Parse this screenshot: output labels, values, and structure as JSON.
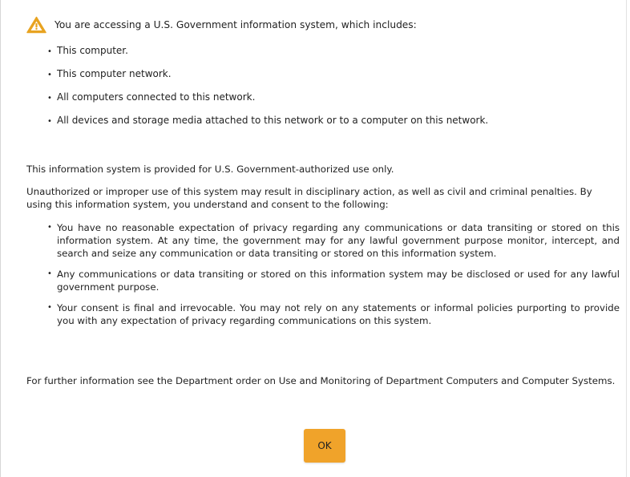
{
  "header": {
    "icon": "warning-icon",
    "warning_color": "#e8a320",
    "text": "You are accessing a U.S. Government information system, which includes:"
  },
  "includes": [
    "This computer.",
    "This computer network.",
    "All computers connected to this network.",
    "All devices and storage media attached to this network or to a computer on this network."
  ],
  "para_authorized": "This information system is provided for U.S. Government-authorized use only.",
  "para_unauthorized": "Unauthorized or improper use of this system may result in disciplinary action, as well as civil and criminal penalties. By using this information system, you understand and consent to the following:",
  "consent": [
    "You have no reasonable expectation of privacy regarding any communications or data transiting or stored on this information system. At any time, the government may for any lawful government purpose monitor, intercept, and search and seize any communication or data transiting or stored on this information system.",
    "Any communications or data transiting or stored on this information system may be disclosed or used for any lawful government purpose.",
    "Your consent is final and irrevocable. You may not rely on any statements or informal policies purporting to provide you with any expectation of privacy regarding communications on this system."
  ],
  "para_further": "For further information see the Department order on Use and Monitoring of Department Computers and Computer Systems.",
  "ok_button": {
    "label": "OK",
    "color": "#f0a32a"
  }
}
